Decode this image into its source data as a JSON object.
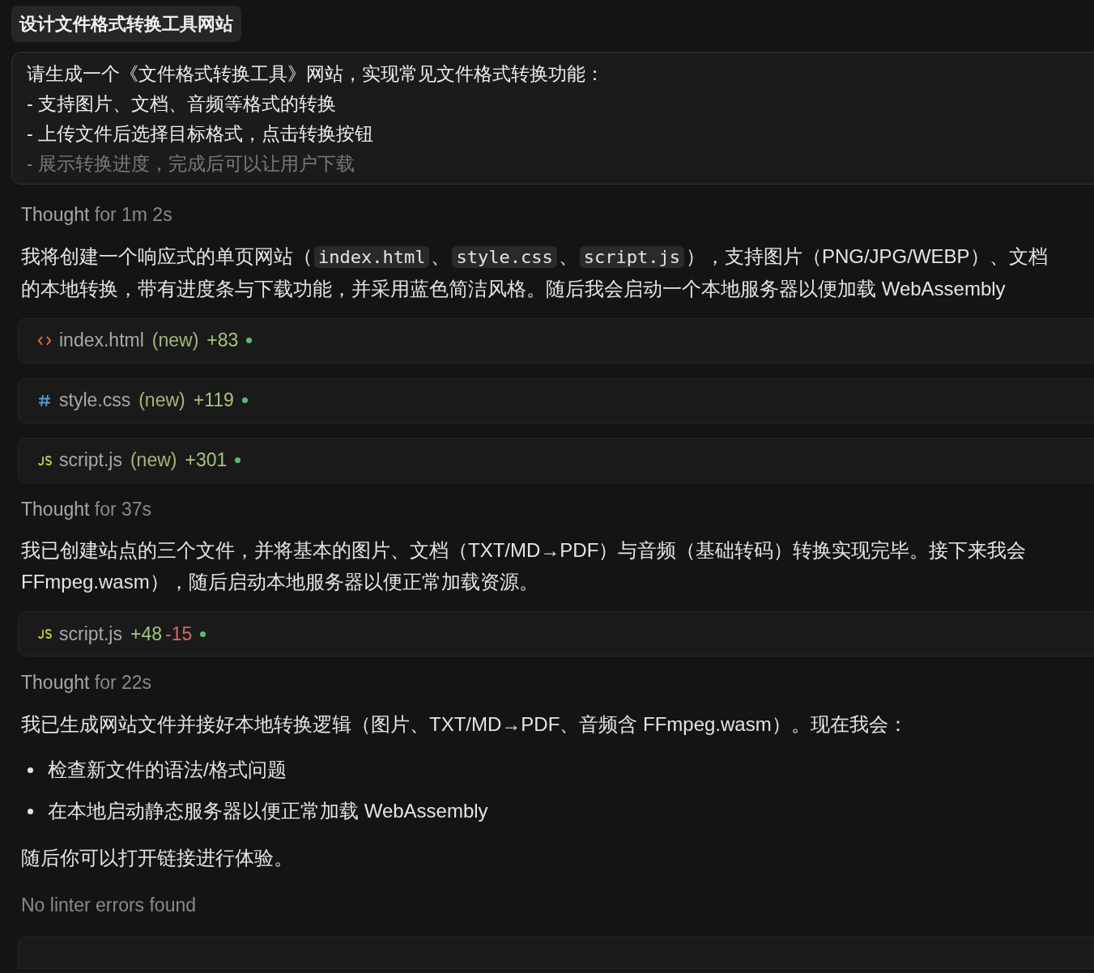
{
  "title": "设计文件格式转换工具网站",
  "prompt": {
    "lines": [
      {
        "text": "请生成一个《文件格式转换工具》网站，实现常见文件格式转换功能：",
        "faded": false
      },
      {
        "text": "- 支持图片、文档、音频等格式的转换",
        "faded": false
      },
      {
        "text": "- 上传文件后选择目标格式，点击转换按钮",
        "faded": false
      },
      {
        "text": "- 展示转换进度，完成后可以让用户下载",
        "faded": true
      }
    ]
  },
  "blocks": [
    {
      "kind": "thought",
      "label": "Thought",
      "duration": "for 1m 2s"
    },
    {
      "kind": "paragraph",
      "lines": [
        [
          {
            "kind": "text",
            "text": "我将创建一个响应式的单页网站（"
          },
          {
            "kind": "code",
            "text": "index.html"
          },
          {
            "kind": "text",
            "text": "、"
          },
          {
            "kind": "code",
            "text": "style.css"
          },
          {
            "kind": "text",
            "text": "、"
          },
          {
            "kind": "code",
            "text": "script.js"
          },
          {
            "kind": "text",
            "text": "），支持图片（PNG/JPG/WEBP）、文档"
          }
        ],
        [
          {
            "kind": "text",
            "text": "的本地转换，带有进度条与下载功能，并采用蓝色简洁风格。随后我会启动一个本地服务器以便加载 WebAssembly"
          }
        ]
      ]
    },
    {
      "kind": "html_file",
      "name": "index.html",
      "tag": "(new)",
      "added": "+83"
    },
    {
      "kind": "css_file",
      "name": "style.css",
      "tag": "(new)",
      "added": "+119"
    },
    {
      "kind": "js_file",
      "name": "script.js",
      "tag": "(new)",
      "added": "+301"
    },
    {
      "kind": "thought",
      "label": "Thought",
      "duration": "for 37s"
    },
    {
      "kind": "paragraph",
      "lines": [
        [
          {
            "kind": "text",
            "text": "我已创建站点的三个文件，并将基本的图片、文档（TXT/MD→PDF）与音频（基础转码）转换实现完毕。接下来我会"
          }
        ],
        [
          {
            "kind": "text",
            "text": "FFmpeg.wasm），随后启动本地服务器以便正常加载资源。"
          }
        ]
      ]
    },
    {
      "kind": "js_file",
      "name": "script.js",
      "added": "+48",
      "removed": "-15"
    },
    {
      "kind": "thought",
      "label": "Thought",
      "duration": "for 22s"
    },
    {
      "kind": "paragraph",
      "lines": [
        [
          {
            "kind": "text",
            "text": "我已生成网站文件并接好本地转换逻辑（图片、TXT/MD→PDF、音频含 FFmpeg.wasm）。现在我会："
          }
        ]
      ]
    },
    {
      "kind": "bullets",
      "items": [
        "检查新文件的语法/格式问题",
        "在本地启动静态服务器以便正常加载 WebAssembly"
      ]
    },
    {
      "kind": "paragraph",
      "lines": [
        [
          {
            "kind": "text",
            "text": "随后你可以打开链接进行体验。"
          }
        ]
      ]
    },
    {
      "kind": "status",
      "text": "No linter errors found"
    },
    {
      "kind": "empty_card"
    }
  ]
}
